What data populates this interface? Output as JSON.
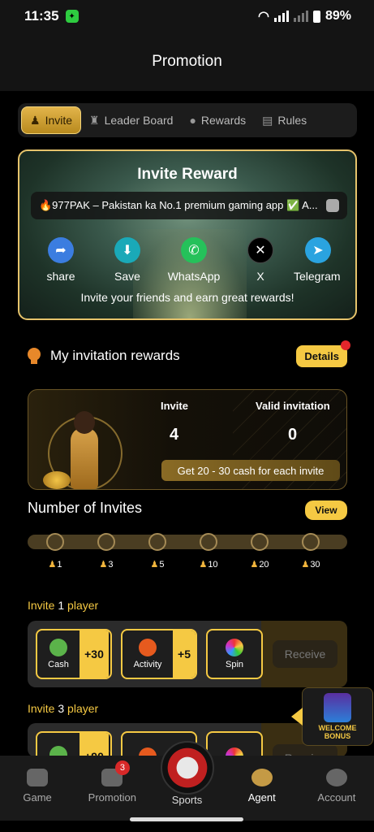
{
  "status": {
    "time": "11:35",
    "battery": "89%"
  },
  "header": {
    "title": "Promotion"
  },
  "tabs": [
    {
      "label": "Invite",
      "icon": "invite-icon"
    },
    {
      "label": "Leader Board",
      "icon": "trophy-icon"
    },
    {
      "label": "Rewards",
      "icon": "medal-icon"
    },
    {
      "label": "Rules",
      "icon": "document-icon"
    }
  ],
  "invite": {
    "title": "Invite Reward",
    "share_text": "🔥977PAK – Pakistan ka No.1 premium gaming app ✅ A...",
    "share_options": [
      {
        "label": "share",
        "icon": "share-icon",
        "color": "#3b7de0"
      },
      {
        "label": "Save",
        "icon": "download-icon",
        "color": "#1aa9b8"
      },
      {
        "label": "WhatsApp",
        "icon": "whatsapp-icon",
        "color": "#25c15a"
      },
      {
        "label": "X",
        "icon": "x-icon",
        "color": "#000000"
      },
      {
        "label": "Telegram",
        "icon": "telegram-icon",
        "color": "#2aa3e0"
      }
    ],
    "subtitle": "Invite your friends and earn great rewards!"
  },
  "my_rewards": {
    "title": "My invitation rewards",
    "details_label": "Details",
    "invite_label": "Invite",
    "invite_value": "4",
    "valid_label": "Valid invitation",
    "valid_value": "0",
    "cash_text": "Get 20 - 30 cash for each invite"
  },
  "invites": {
    "title": "Number of Invites",
    "view_label": "View",
    "milestones": [
      "1",
      "3",
      "5",
      "10",
      "20",
      "30"
    ]
  },
  "tiers": [
    {
      "title_prefix": "Invite ",
      "title_count": "1",
      "title_suffix": " player",
      "rewards": [
        {
          "label": "Cash",
          "amount": "+30",
          "icon": "cash-icon"
        },
        {
          "label": "Activity",
          "amount": "+5",
          "icon": "fire-icon"
        },
        {
          "label": "Spin",
          "amount": "",
          "icon": "spin-wheel-icon"
        }
      ],
      "receive_label": "Receive"
    },
    {
      "title_prefix": "Invite ",
      "title_count": "3",
      "title_suffix": " player",
      "rewards": [
        {
          "label": "",
          "amount": "+90",
          "icon": "cash-icon"
        },
        {
          "label": "",
          "amount": "",
          "icon": "fire-icon"
        },
        {
          "label": "",
          "amount": "",
          "icon": "spin-wheel-icon"
        }
      ],
      "receive_label": "Receive"
    }
  ],
  "welcome_bonus": {
    "line1": "WELCOME",
    "line2": "BONUS"
  },
  "nav": [
    {
      "label": "Game",
      "icon": "gamepad-icon"
    },
    {
      "label": "Promotion",
      "icon": "promotion-icon",
      "badge": "3"
    },
    {
      "label": "Sports",
      "icon": "world-cup-icon"
    },
    {
      "label": "Agent",
      "icon": "agent-icon"
    },
    {
      "label": "Account",
      "icon": "account-icon"
    }
  ]
}
